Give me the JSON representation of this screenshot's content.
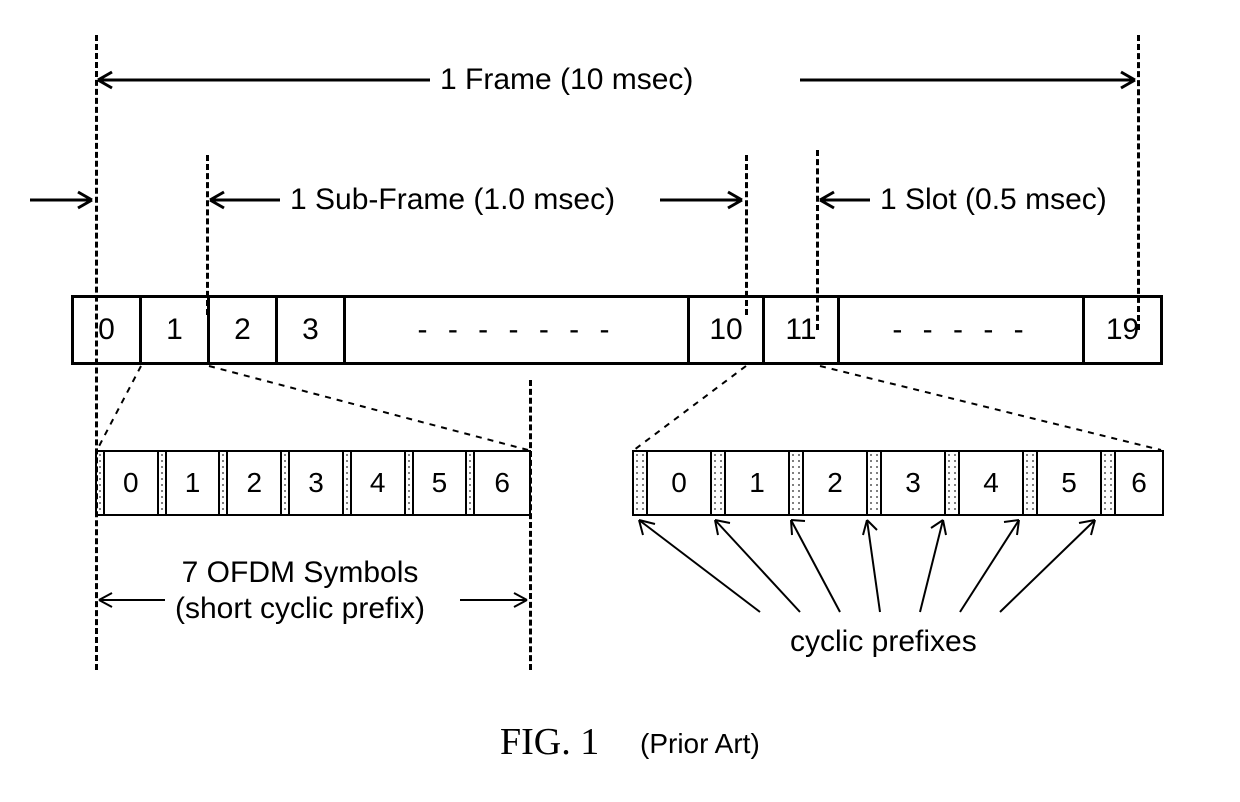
{
  "frame": {
    "label": "1 Frame (10 msec)",
    "subframe_label": "1 Sub-Frame (1.0 msec)",
    "slot_label": "1 Slot (0.5 msec)"
  },
  "slots": {
    "cells": [
      "0",
      "1",
      "2",
      "3",
      "- - - - - - -",
      "10",
      "11",
      "- - - - -",
      "19"
    ]
  },
  "left_symrow": {
    "symbols": [
      "0",
      "1",
      "2",
      "3",
      "4",
      "5",
      "6"
    ],
    "label_line1": "7 OFDM Symbols",
    "label_line2": "(short cyclic prefix)"
  },
  "right_symrow": {
    "symbols": [
      "0",
      "1",
      "2",
      "3",
      "4",
      "5",
      "6"
    ],
    "cp_label": "cyclic prefixes"
  },
  "figure": {
    "title": "FIG. 1",
    "subtitle": "(Prior Art)"
  }
}
